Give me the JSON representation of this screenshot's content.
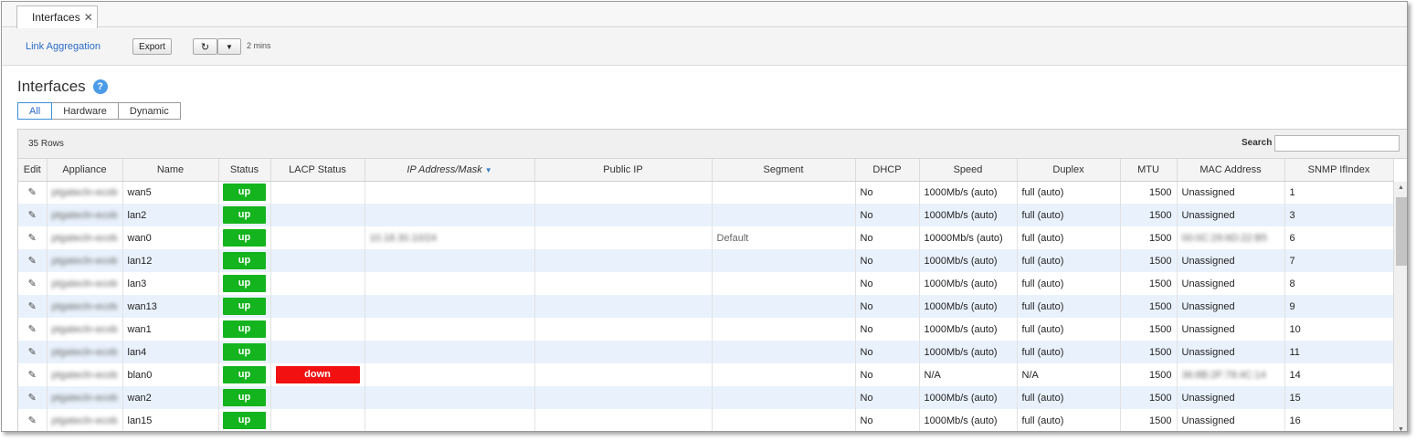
{
  "tabs": [
    {
      "label": "Interfaces",
      "closable": true
    }
  ],
  "toolbar": {
    "link_aggregation": "Link Aggregation",
    "export": "Export",
    "refresh_icon": "refresh-icon",
    "refresh_interval": "2 mins"
  },
  "page": {
    "title": "Interfaces",
    "help_glyph": "?",
    "filters": [
      {
        "label": "All",
        "active": true
      },
      {
        "label": "Hardware",
        "active": false
      },
      {
        "label": "Dynamic",
        "active": false
      }
    ]
  },
  "grid": {
    "rows_count": "35 Rows",
    "search_label": "Search",
    "search_value": "",
    "sort_column": "IP Address/Mask",
    "sort_direction": "descending",
    "columns": [
      "Edit",
      "Appliance",
      "Name",
      "Status",
      "LACP Status",
      "IP Address/Mask",
      "Public IP",
      "Segment",
      "DHCP",
      "Speed",
      "Duplex",
      "MTU",
      "MAC Address",
      "SNMP IfIndex"
    ],
    "rows": [
      {
        "appliance": "ptgatecln-ecob",
        "name": "wan5",
        "status": "up",
        "lacp": "",
        "ip": "",
        "public_ip": "",
        "segment": "",
        "dhcp": "No",
        "speed": "1000Mb/s (auto)",
        "duplex": "full (auto)",
        "mtu": "1500",
        "mac": "Unassigned",
        "snmp": "1"
      },
      {
        "appliance": "ptgatecln-ecob",
        "name": "lan2",
        "status": "up",
        "lacp": "",
        "ip": "",
        "public_ip": "",
        "segment": "",
        "dhcp": "No",
        "speed": "1000Mb/s (auto)",
        "duplex": "full (auto)",
        "mtu": "1500",
        "mac": "Unassigned",
        "snmp": "3"
      },
      {
        "appliance": "ptgatecln-ecob",
        "name": "wan0",
        "status": "up",
        "lacp": "",
        "ip": "10.18.30.10/24",
        "public_ip": "",
        "segment": "Default",
        "dhcp": "No",
        "speed": "10000Mb/s (auto)",
        "duplex": "full (auto)",
        "mtu": "1500",
        "mac": "00:0C:29:6D:22:B5",
        "snmp": "6"
      },
      {
        "appliance": "ptgatecln-ecob",
        "name": "lan12",
        "status": "up",
        "lacp": "",
        "ip": "",
        "public_ip": "",
        "segment": "",
        "dhcp": "No",
        "speed": "1000Mb/s (auto)",
        "duplex": "full (auto)",
        "mtu": "1500",
        "mac": "Unassigned",
        "snmp": "7"
      },
      {
        "appliance": "ptgatecln-ecob",
        "name": "lan3",
        "status": "up",
        "lacp": "",
        "ip": "",
        "public_ip": "",
        "segment": "",
        "dhcp": "No",
        "speed": "1000Mb/s (auto)",
        "duplex": "full (auto)",
        "mtu": "1500",
        "mac": "Unassigned",
        "snmp": "8"
      },
      {
        "appliance": "ptgatecln-ecob",
        "name": "wan13",
        "status": "up",
        "lacp": "",
        "ip": "",
        "public_ip": "",
        "segment": "",
        "dhcp": "No",
        "speed": "1000Mb/s (auto)",
        "duplex": "full (auto)",
        "mtu": "1500",
        "mac": "Unassigned",
        "snmp": "9"
      },
      {
        "appliance": "ptgatecln-ecob",
        "name": "wan1",
        "status": "up",
        "lacp": "",
        "ip": "",
        "public_ip": "",
        "segment": "",
        "dhcp": "No",
        "speed": "1000Mb/s (auto)",
        "duplex": "full (auto)",
        "mtu": "1500",
        "mac": "Unassigned",
        "snmp": "10"
      },
      {
        "appliance": "ptgatecln-ecob",
        "name": "lan4",
        "status": "up",
        "lacp": "",
        "ip": "",
        "public_ip": "",
        "segment": "",
        "dhcp": "No",
        "speed": "1000Mb/s (auto)",
        "duplex": "full (auto)",
        "mtu": "1500",
        "mac": "Unassigned",
        "snmp": "11"
      },
      {
        "appliance": "ptgatecln-ecob",
        "name": "blan0",
        "status": "up",
        "lacp": "down",
        "ip": "",
        "public_ip": "",
        "segment": "",
        "dhcp": "No",
        "speed": "N/A",
        "duplex": "N/A",
        "mtu": "1500",
        "mac": "36:8B:2F:78:4C:14",
        "snmp": "14"
      },
      {
        "appliance": "ptgatecln-ecob",
        "name": "wan2",
        "status": "up",
        "lacp": "",
        "ip": "",
        "public_ip": "",
        "segment": "",
        "dhcp": "No",
        "speed": "1000Mb/s (auto)",
        "duplex": "full (auto)",
        "mtu": "1500",
        "mac": "Unassigned",
        "snmp": "15"
      },
      {
        "appliance": "ptgatecln-ecob",
        "name": "lan15",
        "status": "up",
        "lacp": "",
        "ip": "",
        "public_ip": "",
        "segment": "",
        "dhcp": "No",
        "speed": "1000Mb/s (auto)",
        "duplex": "full (auto)",
        "mtu": "1500",
        "mac": "Unassigned",
        "snmp": "16"
      }
    ],
    "blurred_fields": [
      "appliance",
      "ip",
      "mac"
    ]
  },
  "colors": {
    "status_up": "#14b41e",
    "status_down": "#f21010",
    "row_alt": "#e9f2fc",
    "accent": "#2a6bc8"
  }
}
